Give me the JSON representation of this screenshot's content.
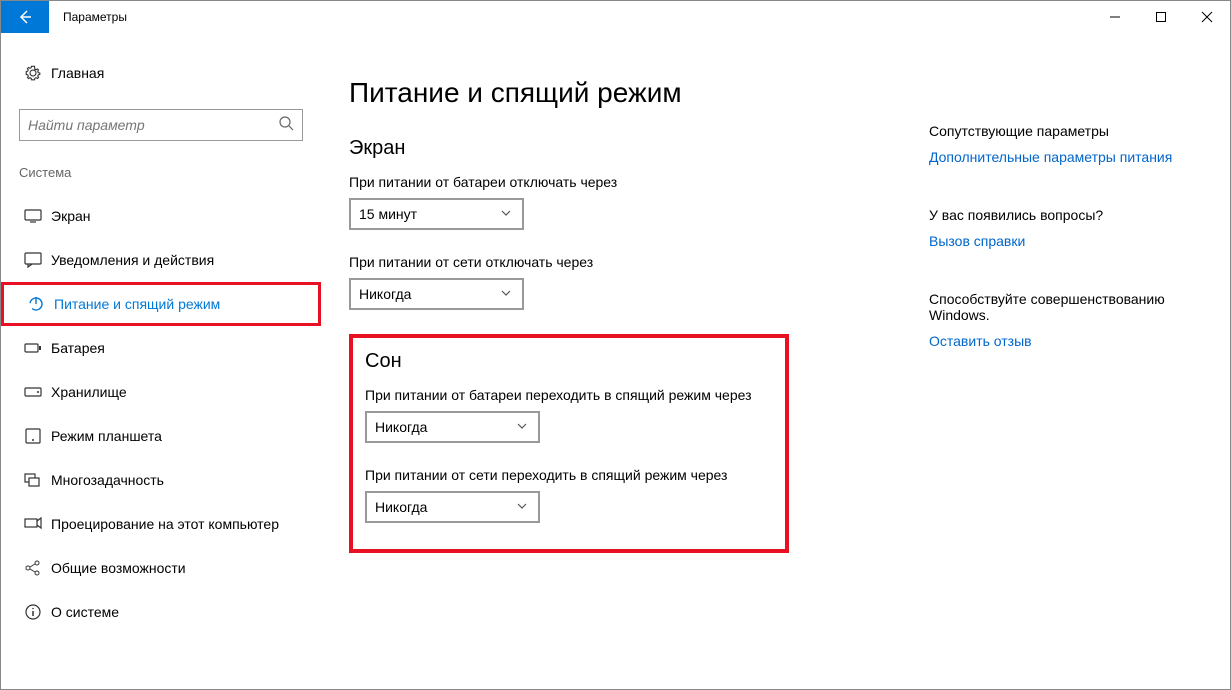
{
  "window": {
    "title": "Параметры"
  },
  "sidebar": {
    "home": "Главная",
    "search_placeholder": "Найти параметр",
    "category": "Система",
    "items": [
      {
        "label": "Экран"
      },
      {
        "label": "Уведомления и действия"
      },
      {
        "label": "Питание и спящий режим"
      },
      {
        "label": "Батарея"
      },
      {
        "label": "Хранилище"
      },
      {
        "label": "Режим планшета"
      },
      {
        "label": "Многозадачность"
      },
      {
        "label": "Проецирование на этот компьютер"
      },
      {
        "label": "Общие возможности"
      },
      {
        "label": "О системе"
      }
    ]
  },
  "main": {
    "title": "Питание и спящий режим",
    "screen_section": "Экран",
    "screen_battery_label": "При питании от батареи отключать через",
    "screen_battery_value": "15 минут",
    "screen_ac_label": "При питании от сети отключать через",
    "screen_ac_value": "Никогда",
    "sleep_section": "Сон",
    "sleep_battery_label": "При питании от батареи переходить в спящий режим через",
    "sleep_battery_value": "Никогда",
    "sleep_ac_label": "При питании от сети переходить в спящий режим через",
    "sleep_ac_value": "Никогда"
  },
  "right": {
    "related_title": "Сопутствующие параметры",
    "related_link": "Дополнительные параметры питания",
    "questions_title": "У вас появились вопросы?",
    "questions_link": "Вызов справки",
    "feedback_title": "Способствуйте совершенствованию Windows.",
    "feedback_link": "Оставить отзыв"
  }
}
